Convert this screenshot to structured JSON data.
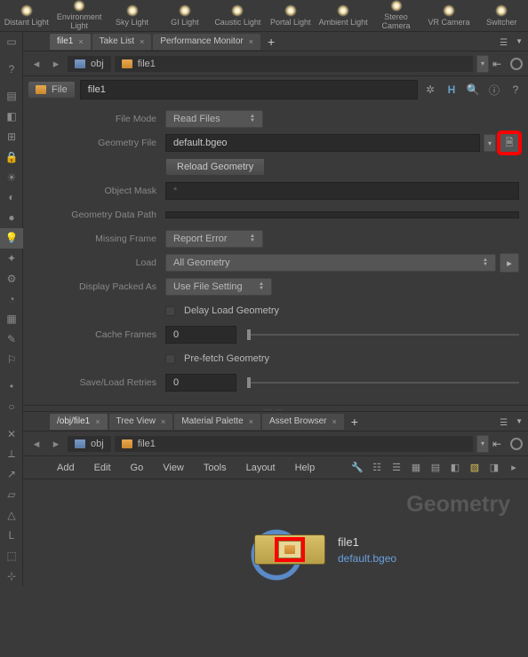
{
  "shelf": [
    {
      "label": "Distant Light"
    },
    {
      "label": "Environment Light"
    },
    {
      "label": "Sky Light"
    },
    {
      "label": "GI Light"
    },
    {
      "label": "Caustic Light"
    },
    {
      "label": "Portal Light"
    },
    {
      "label": "Ambient Light"
    },
    {
      "label": "Stereo Camera"
    },
    {
      "label": "VR Camera"
    },
    {
      "label": "Switcher"
    }
  ],
  "upper_tabs": [
    {
      "label": "file1",
      "active": true
    },
    {
      "label": "Take List",
      "active": false
    },
    {
      "label": "Performance Monitor",
      "active": false
    }
  ],
  "path": {
    "nav1": "obj",
    "nav2": "file1"
  },
  "file_header": {
    "chip": "File",
    "name": "file1"
  },
  "params": {
    "file_mode": {
      "label": "File Mode",
      "value": "Read Files"
    },
    "geometry_file": {
      "label": "Geometry File",
      "value": "default.bgeo"
    },
    "reload": "Reload Geometry",
    "object_mask": {
      "label": "Object Mask",
      "value": "*"
    },
    "geometry_data_path": {
      "label": "Geometry Data Path",
      "value": ""
    },
    "missing_frame": {
      "label": "Missing Frame",
      "value": "Report Error"
    },
    "load": {
      "label": "Load",
      "value": "All Geometry"
    },
    "display_packed_as": {
      "label": "Display Packed As",
      "value": "Use File Setting"
    },
    "delay_load": "Delay Load Geometry",
    "cache_frames": {
      "label": "Cache Frames",
      "value": "0"
    },
    "prefetch": "Pre-fetch Geometry",
    "save_load_retries": {
      "label": "Save/Load Retries",
      "value": "0"
    }
  },
  "lower_tabs": [
    {
      "label": "/obj/file1",
      "active": true
    },
    {
      "label": "Tree View",
      "active": false
    },
    {
      "label": "Material Palette",
      "active": false
    },
    {
      "label": "Asset Browser",
      "active": false
    }
  ],
  "menus": [
    "Add",
    "Edit",
    "Go",
    "View",
    "Tools",
    "Layout",
    "Help"
  ],
  "network": {
    "bg_text": "Geometry",
    "node_name": "file1",
    "node_file": "default.bgeo"
  },
  "colors": {
    "highlight": "#ff0000",
    "link": "#6aa0e0"
  }
}
